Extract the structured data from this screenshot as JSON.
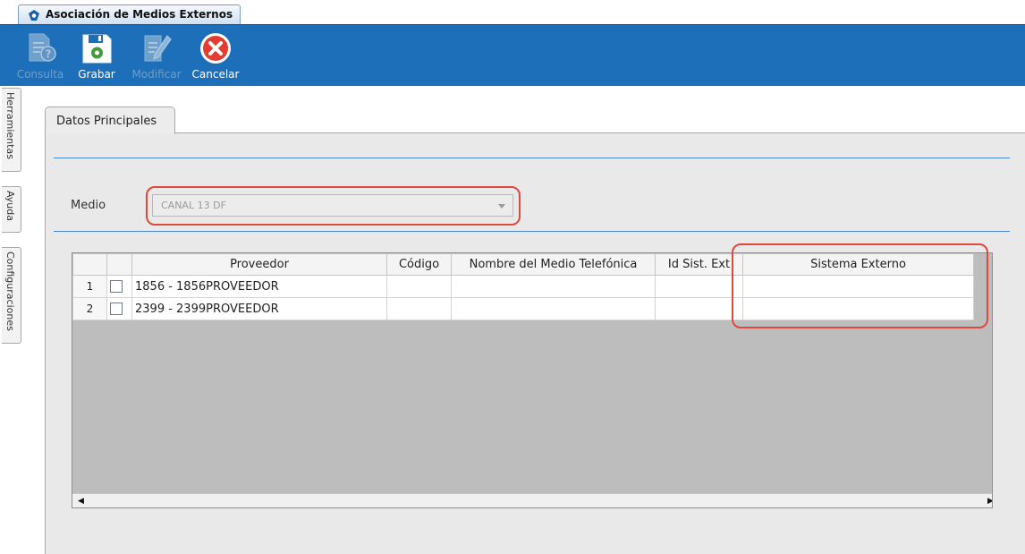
{
  "window": {
    "tab_title": "Asociación de Medios Externos"
  },
  "toolbar": {
    "items": [
      {
        "label": "Consulta",
        "icon": "consulta-icon",
        "enabled": false
      },
      {
        "label": "Grabar",
        "icon": "save-icon",
        "enabled": true
      },
      {
        "label": "Modificar",
        "icon": "edit-icon",
        "enabled": false
      },
      {
        "label": "Cancelar",
        "icon": "cancel-icon",
        "enabled": true
      }
    ]
  },
  "side_tabs": [
    "Herramientas",
    "Ayuda",
    "Configuraciones"
  ],
  "panel": {
    "tab_label": "Datos Principales",
    "medio": {
      "label": "Medio",
      "value": "CANAL 13 DF",
      "enabled": false
    }
  },
  "grid": {
    "columns": [
      "",
      "",
      "Proveedor",
      "Código",
      "Nombre del Medio Telefónica",
      "Id Sist. Ext",
      "Sistema Externo"
    ],
    "rows": [
      {
        "num": "1",
        "checked": false,
        "proveedor": "1856 - 1856PROVEEDOR",
        "codigo": "",
        "nombre_medio": "",
        "id_sist_ext": "",
        "sistema_externo": ""
      },
      {
        "num": "2",
        "checked": false,
        "proveedor": "2399 - 2399PROVEEDOR",
        "codigo": "",
        "nombre_medio": "",
        "id_sist_ext": "",
        "sistema_externo": ""
      }
    ]
  },
  "colors": {
    "toolbar_bg": "#1c6fb8",
    "highlight": "#dc4a3b",
    "separator": "#4a86c5"
  }
}
